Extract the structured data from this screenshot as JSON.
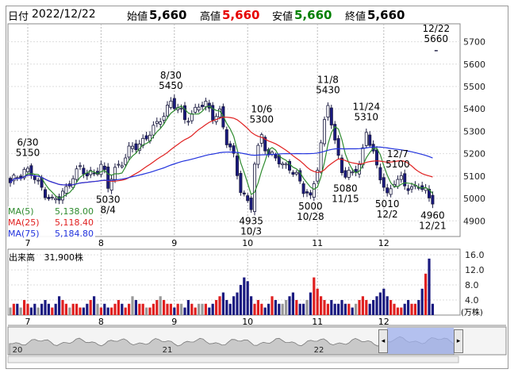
{
  "header": {
    "date_label": "日付",
    "date_value": "2022/12/22",
    "open_label": "始値",
    "open_value": "5,660",
    "high_label": "高値",
    "high_value": "5,660",
    "low_label": "安値",
    "low_value": "5,660",
    "close_label": "終値",
    "close_value": "5,660",
    "colors": {
      "high": "#e60000",
      "low": "#008000",
      "normal": "#000000"
    }
  },
  "ma_legend": [
    {
      "label": "MA(5)",
      "value": "5,138.00",
      "color": "#2e8b2e"
    },
    {
      "label": "MA(25)",
      "value": "5,118.40",
      "color": "#e02020"
    },
    {
      "label": "MA(75)",
      "value": "5,184.80",
      "color": "#2233dd"
    }
  ],
  "volume": {
    "label": "出来高",
    "value": "31,900株",
    "unit": "(万株)"
  },
  "navigator": {
    "labels": [
      "20",
      "21",
      "22"
    ],
    "left_arrow": "◂",
    "right_arrow": "▸"
  },
  "chart_data": {
    "type": "candlestick",
    "price_axis": {
      "ticks": [
        4900,
        5000,
        5100,
        5200,
        5300,
        5400,
        5500,
        5600,
        5700
      ],
      "ylim": [
        4830,
        5780
      ]
    },
    "volume_axis": {
      "ticks": [
        4.0,
        8.0,
        12.0,
        16.0
      ],
      "ylim": [
        0,
        17.5
      ]
    },
    "month_labels": [
      {
        "label": "7",
        "index": 5
      },
      {
        "label": "8",
        "index": 26
      },
      {
        "label": "9",
        "index": 47
      },
      {
        "label": "10",
        "index": 68
      },
      {
        "label": "11",
        "index": 88
      },
      {
        "label": "12",
        "index": 107
      }
    ],
    "annotations": [
      {
        "date": "6/30",
        "value": 5150,
        "index": 5,
        "pos": "above"
      },
      {
        "date": "8/4",
        "value": 5030,
        "index": 28,
        "pos": "below"
      },
      {
        "date": "8/30",
        "value": 5450,
        "index": 46,
        "pos": "above"
      },
      {
        "date": "10/3",
        "value": 4935,
        "index": 69,
        "pos": "below"
      },
      {
        "date": "10/6",
        "value": 5300,
        "index": 72,
        "pos": "above"
      },
      {
        "date": "10/28",
        "value": 5000,
        "index": 86,
        "pos": "below"
      },
      {
        "date": "11/8",
        "value": 5430,
        "index": 91,
        "pos": "above"
      },
      {
        "date": "11/15",
        "value": 5080,
        "index": 96,
        "pos": "below"
      },
      {
        "date": "11/24",
        "value": 5310,
        "index": 102,
        "pos": "above"
      },
      {
        "date": "12/2",
        "value": 5010,
        "index": 108,
        "pos": "below"
      },
      {
        "date": "12/7",
        "value": 5100,
        "index": 111,
        "pos": "above"
      },
      {
        "date": "12/21",
        "value": 4960,
        "index": 121,
        "pos": "below"
      },
      {
        "date": "12/22",
        "value": 5660,
        "index": 122,
        "pos": "above"
      }
    ],
    "waypoints": [
      [
        0,
        5060
      ],
      [
        2,
        5100
      ],
      [
        4,
        5130
      ],
      [
        6,
        5110
      ],
      [
        8,
        5060
      ],
      [
        10,
        5030
      ],
      [
        12,
        4990
      ],
      [
        14,
        5000
      ],
      [
        16,
        5040
      ],
      [
        18,
        5110
      ],
      [
        20,
        5130
      ],
      [
        22,
        5100
      ],
      [
        24,
        5120
      ],
      [
        26,
        5150
      ],
      [
        28,
        5060
      ],
      [
        30,
        5130
      ],
      [
        32,
        5170
      ],
      [
        34,
        5210
      ],
      [
        36,
        5230
      ],
      [
        38,
        5260
      ],
      [
        40,
        5300
      ],
      [
        42,
        5320
      ],
      [
        44,
        5380
      ],
      [
        46,
        5440
      ],
      [
        48,
        5400
      ],
      [
        50,
        5350
      ],
      [
        52,
        5380
      ],
      [
        54,
        5420
      ],
      [
        56,
        5410
      ],
      [
        58,
        5370
      ],
      [
        60,
        5390
      ],
      [
        62,
        5250
      ],
      [
        64,
        5180
      ],
      [
        66,
        5050
      ],
      [
        68,
        4980
      ],
      [
        69,
        4940
      ],
      [
        70,
        5150
      ],
      [
        72,
        5280
      ],
      [
        74,
        5200
      ],
      [
        76,
        5180
      ],
      [
        78,
        5140
      ],
      [
        80,
        5150
      ],
      [
        82,
        5100
      ],
      [
        84,
        5030
      ],
      [
        86,
        5010
      ],
      [
        88,
        5150
      ],
      [
        90,
        5330
      ],
      [
        91,
        5420
      ],
      [
        93,
        5250
      ],
      [
        95,
        5140
      ],
      [
        96,
        5090
      ],
      [
        98,
        5110
      ],
      [
        100,
        5150
      ],
      [
        102,
        5290
      ],
      [
        103,
        5250
      ],
      [
        105,
        5130
      ],
      [
        107,
        5060
      ],
      [
        108,
        5020
      ],
      [
        110,
        5080
      ],
      [
        111,
        5090
      ],
      [
        113,
        5060
      ],
      [
        115,
        5050
      ],
      [
        117,
        5060
      ],
      [
        119,
        5020
      ],
      [
        121,
        4970
      ],
      [
        122,
        5120
      ]
    ],
    "volume_profile": [
      2,
      3,
      3,
      2,
      4,
      3,
      2,
      3,
      2,
      3,
      4,
      3,
      2,
      3,
      5,
      4,
      3,
      2,
      3,
      3,
      2,
      2,
      3,
      4,
      5,
      3,
      2,
      3,
      2,
      2,
      3,
      4,
      3,
      2,
      3,
      5,
      4,
      3,
      3,
      2,
      2,
      3,
      4,
      5,
      4,
      3,
      3,
      2,
      3,
      3,
      2,
      4,
      3,
      2,
      3,
      3,
      3,
      2,
      3,
      4,
      5,
      6,
      4,
      3,
      5,
      6,
      8,
      10,
      9,
      5,
      3,
      4,
      3,
      2,
      3,
      5,
      4,
      3,
      3,
      4,
      5,
      6,
      4,
      3,
      3,
      4,
      6,
      10,
      7,
      5,
      4,
      3,
      4,
      3,
      3,
      4,
      3,
      3,
      2,
      3,
      4,
      5,
      4,
      3,
      4,
      5,
      6,
      7,
      5,
      4,
      3,
      2,
      2,
      3,
      4,
      3,
      3,
      4,
      7,
      11,
      15,
      3
    ],
    "colors": {
      "up_body": "#ffffff",
      "down_body": "#1a1a80",
      "ma5": "#2e8b2e",
      "ma25": "#e02020",
      "ma75": "#2233dd",
      "vol_up": "#e02020",
      "vol_down": "#1a1a80",
      "vol_flat": "#999999",
      "nav_fill": "#9fb0ee"
    }
  }
}
